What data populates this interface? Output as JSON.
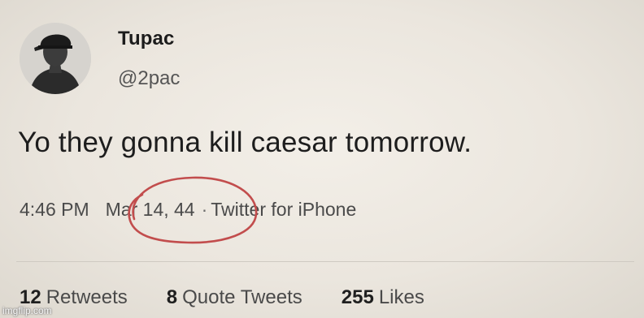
{
  "user": {
    "display_name": "Tupac",
    "handle": "@2pac"
  },
  "tweet": {
    "text": "Yo they gonna kill caesar tomorrow.",
    "time": "4:46 PM",
    "date": "Mar 14, 44",
    "separator": "·",
    "source": "Twitter for iPhone"
  },
  "stats": {
    "retweets": {
      "count": "12",
      "label": "Retweets"
    },
    "quote_tweets": {
      "count": "8",
      "label": "Quote Tweets"
    },
    "likes": {
      "count": "255",
      "label": "Likes"
    }
  },
  "annotation": {
    "circle_color": "#c24d4d"
  },
  "watermark": "imgflip.com"
}
